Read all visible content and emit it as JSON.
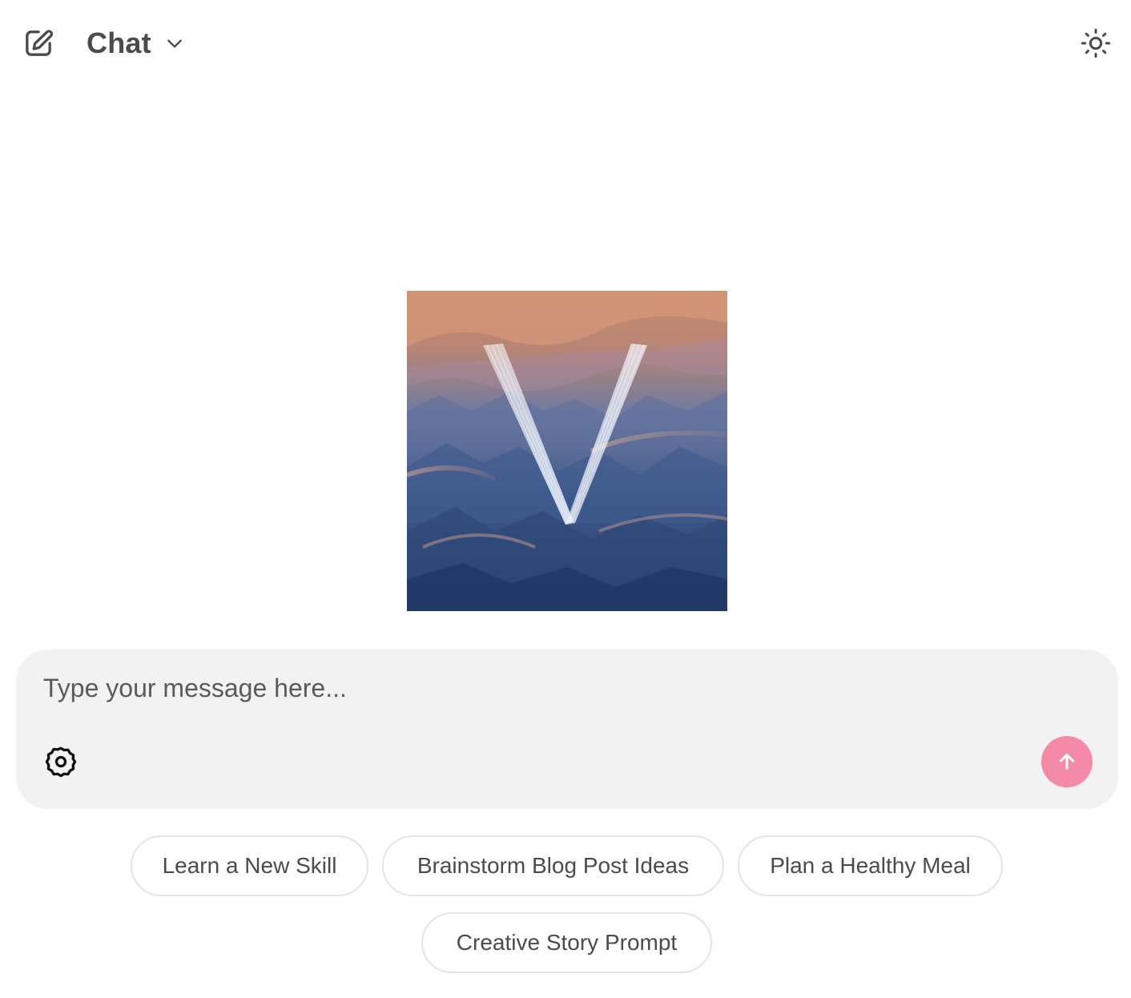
{
  "header": {
    "new_chat_icon": "edit-pencil-square-icon",
    "model_label": "Chat",
    "model_dropdown_icon": "chevron-down-icon",
    "theme_icon": "sun-icon"
  },
  "logo": {
    "letter": "V",
    "style": "mountain landscape with glowing V"
  },
  "composer": {
    "placeholder": "Type your message here...",
    "value": "",
    "settings_icon": "gear-icon",
    "send_icon": "arrow-up-icon"
  },
  "suggestions": [
    {
      "label": "Learn a New Skill"
    },
    {
      "label": "Brainstorm Blog Post Ideas"
    },
    {
      "label": "Plan a Healthy Meal"
    },
    {
      "label": "Creative Story Prompt"
    }
  ],
  "colors": {
    "accent_send": "#f48aa6",
    "composer_bg": "#f2f2f2",
    "chip_border": "#e4e4e7",
    "text": "#4b4b4b"
  }
}
